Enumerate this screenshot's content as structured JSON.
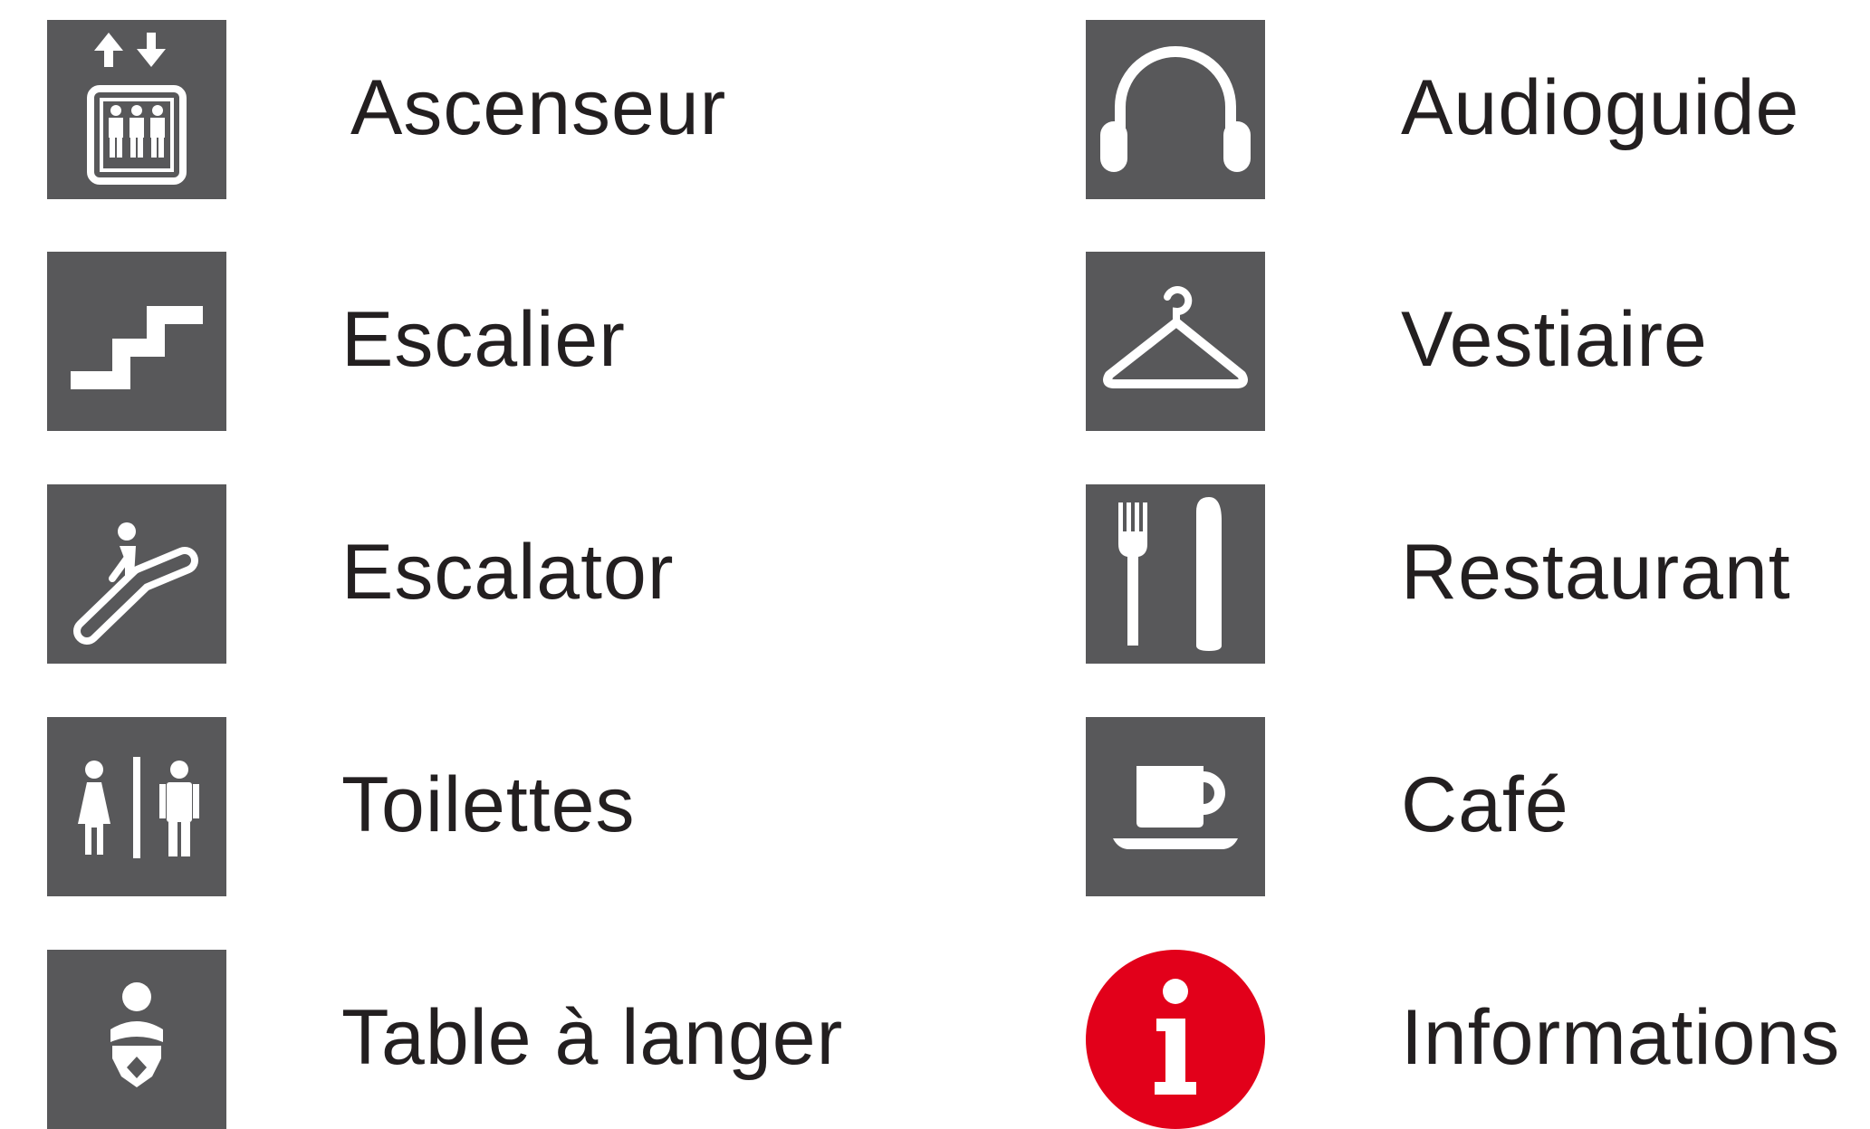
{
  "colors": {
    "tile": "#58585a",
    "info": "#e2001a",
    "glyph": "#ffffff",
    "text": "#231f20"
  },
  "left_column": [
    {
      "icon": "elevator-icon",
      "label": "Ascenseur"
    },
    {
      "icon": "stairs-icon",
      "label": "Escalier"
    },
    {
      "icon": "escalator-icon",
      "label": "Escalator"
    },
    {
      "icon": "toilets-icon",
      "label": "Toilettes"
    },
    {
      "icon": "baby-changing-icon",
      "label": "Table à langer"
    }
  ],
  "right_column": [
    {
      "icon": "headphones-icon",
      "label": "Audioguide"
    },
    {
      "icon": "coat-hanger-icon",
      "label": "Vestiaire"
    },
    {
      "icon": "fork-knife-icon",
      "label": "Restaurant"
    },
    {
      "icon": "coffee-cup-icon",
      "label": "Café"
    },
    {
      "icon": "information-icon",
      "label": "Informations"
    }
  ]
}
